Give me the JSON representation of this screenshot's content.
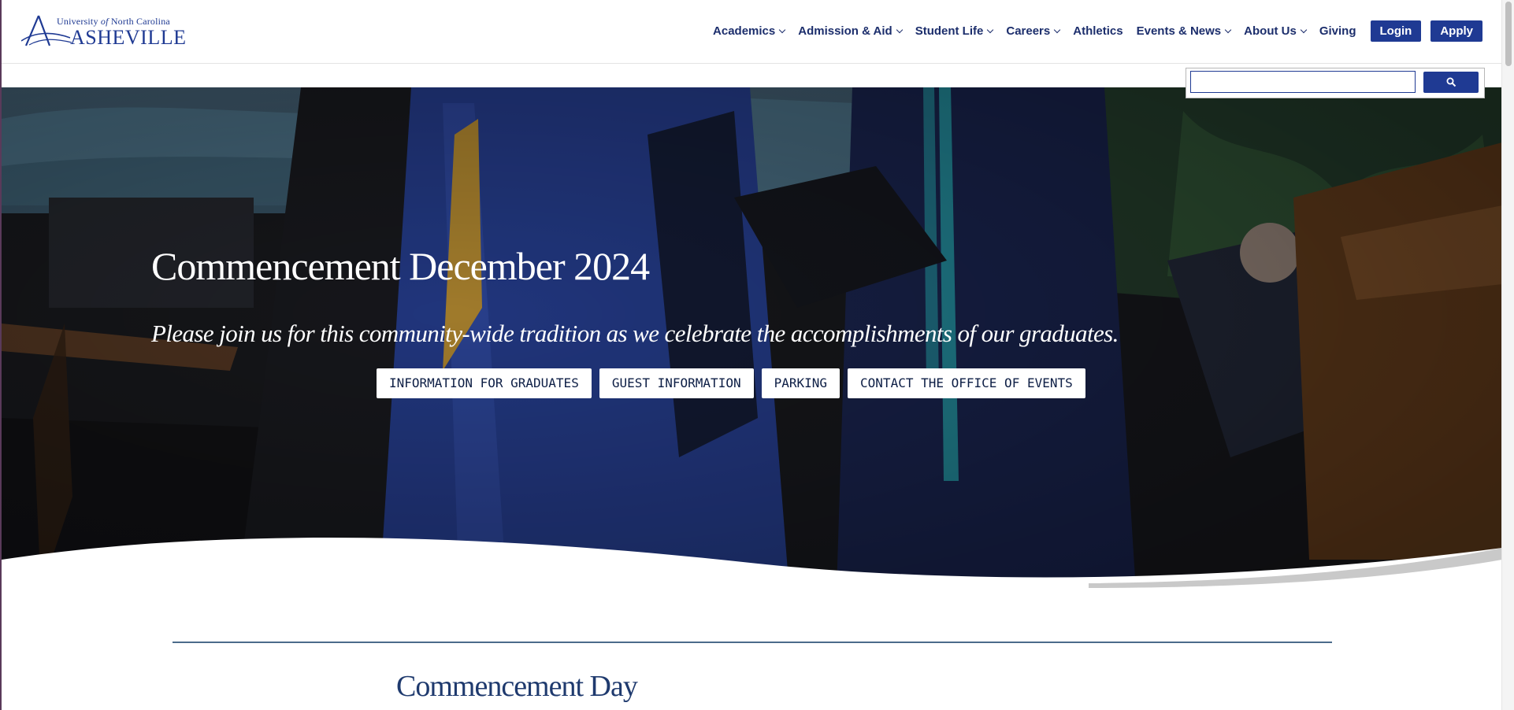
{
  "logo": {
    "line1_part1": "University",
    "line1_of": "of",
    "line1_part2": "North Carolina",
    "line2": "ASHEVILLE"
  },
  "nav": {
    "items": [
      {
        "label": "Academics",
        "dropdown": true
      },
      {
        "label": "Admission & Aid",
        "dropdown": true
      },
      {
        "label": "Student Life",
        "dropdown": true
      },
      {
        "label": "Careers",
        "dropdown": true
      },
      {
        "label": "Athletics",
        "dropdown": false
      },
      {
        "label": "Events & News",
        "dropdown": true
      },
      {
        "label": "About Us",
        "dropdown": true
      },
      {
        "label": "Giving",
        "dropdown": false
      }
    ],
    "login": "Login",
    "apply": "Apply"
  },
  "search": {
    "value": "",
    "icon": "search-icon"
  },
  "hero": {
    "title": "Commencement December 2024",
    "subtitle": "Please join us for this community-wide tradition as we celebrate the accomplishments of our graduates.",
    "buttons": [
      "INFORMATION FOR GRADUATES",
      "GUEST INFORMATION",
      "PARKING",
      "CONTACT THE OFFICE OF EVENTS"
    ]
  },
  "section": {
    "heading": "Commencement Day"
  },
  "colors": {
    "brand_blue": "#1f3a93",
    "nav_text": "#1c2e6c",
    "heading_blue": "#1f3a6e"
  }
}
